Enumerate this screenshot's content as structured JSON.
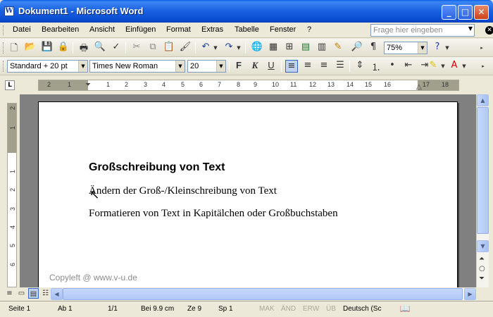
{
  "window": {
    "title": "Dokument1 - Microsoft Word",
    "app_icon_glyph": "W",
    "buttons": [
      "minimize",
      "maximize",
      "close"
    ]
  },
  "menu": {
    "items": [
      "Datei",
      "Bearbeiten",
      "Ansicht",
      "Einfügen",
      "Format",
      "Extras",
      "Tabelle",
      "Fenster",
      "?"
    ],
    "help_placeholder": "Frage hier eingeben"
  },
  "toolbar_standard": {
    "icons": [
      "new-document-icon",
      "open-icon",
      "save-icon",
      "permission-icon",
      "print-icon",
      "print-preview-icon",
      "spelling-icon",
      "cut-icon",
      "copy-icon",
      "paste-icon",
      "format-painter-icon",
      "undo-icon",
      "redo-icon",
      "hyperlink-icon",
      "tables-borders-icon",
      "insert-table-icon",
      "insert-excel-icon",
      "columns-icon",
      "drawing-icon",
      "document-map-icon",
      "show-formatting-icon",
      "help-icon"
    ],
    "zoom": "75%",
    "show_formatting_glyph": "¶"
  },
  "toolbar_format": {
    "style": "Standard + 20 pt",
    "font": "Times New Roman",
    "size": "20",
    "bold": "F",
    "italic": "K",
    "underline": "U",
    "alignment_active": "left"
  },
  "ruler": {
    "h_numbers": [
      "2",
      "1",
      "1",
      "2",
      "3",
      "4",
      "5",
      "6",
      "7",
      "8",
      "9",
      "10",
      "11",
      "12",
      "13",
      "14",
      "15",
      "16",
      "17",
      "18"
    ],
    "v_numbers": [
      "2",
      "1",
      "1",
      "2",
      "3",
      "4",
      "5",
      "6"
    ],
    "tab_selector": "L"
  },
  "document": {
    "heading": "Großschreibung von Text",
    "paragraphs": [
      "Ändern der Groß-/Kleinschreibung von Text",
      "Formatieren von Text in Kapitälchen oder Großbuchstaben"
    ],
    "watermark": "Copyleft @ www.v-u.de"
  },
  "statusbar": {
    "page": "Seite  1",
    "section": "Ab  1",
    "page_of": "1/1",
    "position": "Bei  9.9 cm",
    "line": "Ze  9",
    "column": "Sp  1",
    "mak": "MAK",
    "and": "ÄND",
    "erw": "ERW",
    "ub": "ÜB",
    "language": "Deutsch (Sc"
  },
  "colors": {
    "titlebar": "#0a5ee6",
    "chrome": "#ece9d8",
    "doc_background": "#808080",
    "page": "#ffffff",
    "selection": "#c1d2ee"
  }
}
